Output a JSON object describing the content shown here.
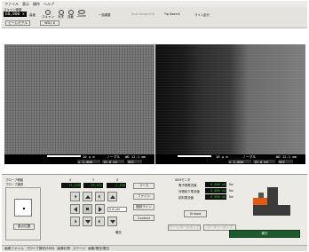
{
  "menu": [
    "ファイル",
    "表示",
    "操作",
    "ヘルプ"
  ],
  "toolbar": {
    "speed_label": "スキャン速度",
    "mag_value": "60,000 x",
    "mode_label": "高速",
    "tab1": "ビームモデル",
    "tab2": "WD1.8",
    "icons": [
      {
        "label": "スキャン",
        "icon": "circle-icon"
      },
      {
        "label": "光学",
        "icon": "circle-icon"
      },
      {
        "label": "自動",
        "icon": "circle-icon"
      },
      {
        "label": "Zoom",
        "icon": "ellipse-icon"
      }
    ],
    "menu_items": [
      "一括調整",
      "Dual Image(F4)",
      "Tip Search",
      "ライン走行"
    ]
  },
  "left_image": {
    "scalebar": "10 μ m",
    "mode": "ノーマル",
    "wd": "WD 12.1 mm",
    "mag": "x 2,000",
    "hv": "15.0 kV",
    "signal": "SEI"
  },
  "right_image": {
    "scalebar": "10 μ m",
    "mode": "ノーマル",
    "wd": "WD 12.1 mm",
    "mag": "x 2,000",
    "hv": "15.0 kV",
    "signal": "SEI"
  },
  "probe": {
    "title": "プローブ移動",
    "subtitle": "プローブ選択",
    "origin_button": "原点位置",
    "axis_labels": [
      "X",
      "Y",
      "Z"
    ],
    "x_value": "-74,528",
    "y_value": "-59,631",
    "z_value": "-1,048",
    "coarse_button": "コース",
    "fine_button": "ファイン",
    "continuous_button": "連続ライン",
    "contact_button": "Contact",
    "step_label": "0.8 μm",
    "step_unit": "確定"
  },
  "semimode": {
    "title": "SEMモニタ",
    "row_labels": [
      "電子銃電流値",
      "対物絞り電流値",
      "試料電流値"
    ],
    "values": [
      "0.000 nA",
      "0.000 nA",
      "0.000 nA"
    ],
    "unit": "Na",
    "unload_button": "Unload",
    "btn_a": "ゲート/ターボポンプ",
    "btn_b": "ロータリーポンプ",
    "execute_button": "実行"
  },
  "statusbar": [
    "画像ファイル",
    "プローブ操作(SEM)",
    "画像計測",
    "ステージ",
    "画像/電流/電位"
  ]
}
